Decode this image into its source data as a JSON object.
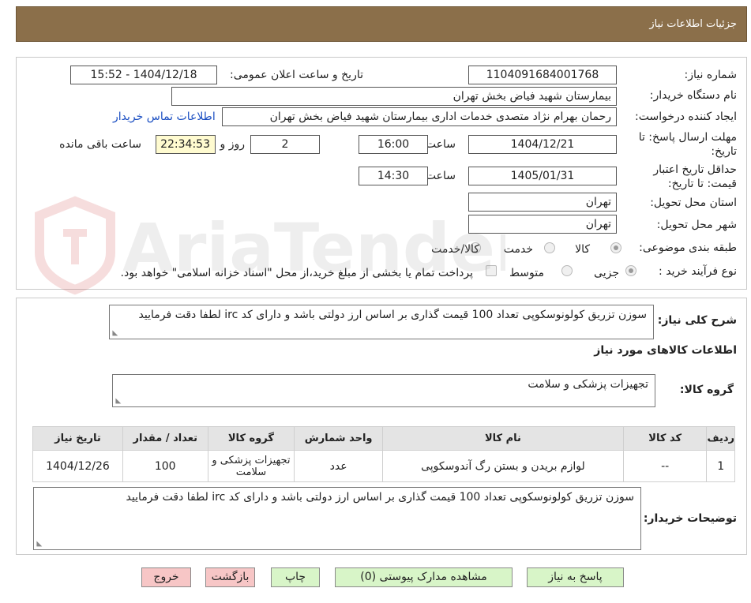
{
  "header": {
    "title": "جزئیات اطلاعات نیاز"
  },
  "form": {
    "need_number_label": "شماره نیاز:",
    "need_number": "1104091684001768",
    "announce_label": "تاریخ و ساعت اعلان عمومی:",
    "announce_value": "1404/12/18 - 15:52",
    "buyer_org_label": "نام دستگاه خریدار:",
    "buyer_org": "بیمارستان شهید فیاض بخش تهران",
    "creator_label": "ایجاد کننده درخواست:",
    "creator": "رحمان بهرام نژاد متصدی خدمات اداری بیمارستان شهید فیاض بخش تهران",
    "contact_link": "اطلاعات تماس خریدار",
    "deadline_label": "مهلت ارسال پاسخ: تا تاریخ:",
    "deadline_date": "1404/12/21",
    "time_label": "ساعت",
    "deadline_time": "16:00",
    "days_value": "2",
    "days_label": "روز و",
    "remaining_time": "22:34:53",
    "remaining_label": "ساعت باقی مانده",
    "validity_label": "حداقل تاریخ اعتبار قیمت: تا تاریخ:",
    "validity_date": "1405/01/31",
    "validity_time": "14:30",
    "province_label": "استان محل تحویل:",
    "province": "تهران",
    "city_label": "شهر محل تحویل:",
    "city": "تهران",
    "category_label": "طبقه بندی موضوعی:",
    "category_options": [
      "کالا",
      "خدمت",
      "کالا/خدمت"
    ],
    "process_label": "نوع فرآیند خرید :",
    "process_options": [
      "جزیی",
      "متوسط"
    ],
    "payment_note": "پرداخت تمام یا بخشی از مبلغ خرید،از محل \"اسناد خزانه اسلامی\" خواهد بود."
  },
  "summary": {
    "label": "شرح کلی نیاز:",
    "text": "سوزن تزریق کولونوسکوپی تعداد 100 قیمت گذاری بر اساس ارز دولتی باشد و دارای کد irc لطفا دقت فرمایید",
    "goods_info_title": "اطلاعات کالاهای مورد نیاز",
    "goods_group_label": "گروه کالا:",
    "goods_group": "تجهیزات پزشکی و سلامت"
  },
  "table": {
    "headers": [
      "ردیف",
      "کد کالا",
      "نام کالا",
      "واحد شمارش",
      "گروه کالا",
      "تعداد / مقدار",
      "تاریخ نیاز"
    ],
    "rows": [
      [
        "1",
        "--",
        "لوازم بریدن و بستن رگ آندوسکوپی",
        "عدد",
        "تجهیزات پزشکی و سلامت",
        "100",
        "1404/12/26"
      ]
    ]
  },
  "buyer_notes": {
    "label": "توضیحات خریدار:",
    "text": "سوزن تزریق کولونوسکوپی تعداد 100 قیمت گذاری بر اساس ارز دولتی باشد و دارای کد irc لطفا دقت فرمایید"
  },
  "buttons": {
    "reply": "پاسخ به نیاز",
    "attachments": "مشاهده مدارک پیوستی (0)",
    "print": "چاپ",
    "back": "بازگشت",
    "exit": "خروج"
  },
  "watermark": {
    "text": "AriaTender.neT"
  },
  "colors": {
    "header": "#8b6f4a",
    "highlight": "#fffbd0",
    "green_button": "#d8f5c8",
    "red_button": "#f7c6c6",
    "link": "#1a4ec2"
  }
}
